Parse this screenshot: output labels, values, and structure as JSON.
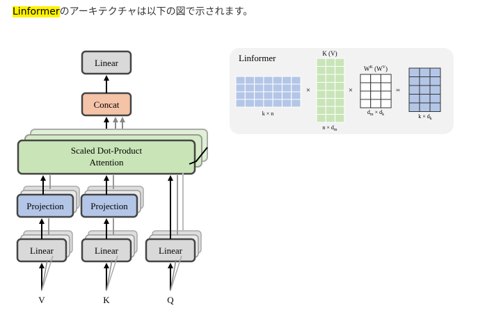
{
  "intro": {
    "highlight": "Linformer",
    "rest": "のアーキテクチャは以下の図で示されます。"
  },
  "arch": {
    "linear_top": "Linear",
    "concat": "Concat",
    "attention_line1": "Scaled Dot-Product",
    "attention_line2": "Attention",
    "projection_v": "Projection",
    "projection_k": "Projection",
    "linear_v": "Linear",
    "linear_k": "Linear",
    "linear_q": "Linear",
    "input_v": "V",
    "input_k": "K",
    "input_q": "Q"
  },
  "panel": {
    "title": "Linformer",
    "mat1_label": "k × n",
    "mat2_top": "K (V)",
    "mat2_label": "n × d",
    "mat2_label_sub": "m",
    "op1": "×",
    "op2": "×",
    "mat3_top_w": "W",
    "mat3_top_sup1": "K",
    "mat3_top_mid": " (W",
    "mat3_top_sup2": "V",
    "mat3_top_end": ")",
    "mat3_label_d1": "d",
    "mat3_label_sub1": "m",
    "mat3_label_mid": " × d",
    "mat3_label_sub2": "k",
    "eq": "=",
    "mat4_label": "k × d",
    "mat4_label_sub": "k"
  },
  "colors": {
    "linear_fill": "#d9d9d9",
    "concat_fill": "#f4c3a8",
    "attention_fill": "#c9e5b8",
    "projection_fill": "#b4c6e7",
    "matrix_blue": "#b4c6e7",
    "matrix_green": "#c9e5b8",
    "highlight": "#fff200"
  }
}
